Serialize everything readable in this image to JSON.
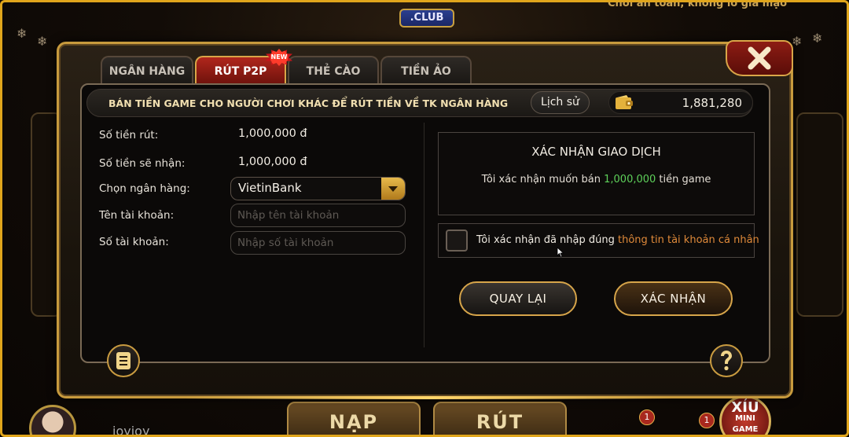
{
  "background": {
    "logo_text": ".CLUB",
    "marquee": "Chơi an toàn, không lo gia mạo",
    "username": "joyjoy",
    "bottom_buttons": [
      "NẠP",
      "RÚT"
    ],
    "mini_game": {
      "line1": "XỈU",
      "line2": "MINI",
      "line3": "GAME"
    },
    "badges": [
      "1",
      "1"
    ]
  },
  "tabs": [
    {
      "label": "NGÂN HÀNG",
      "active": false
    },
    {
      "label": "RÚT P2P",
      "active": true
    },
    {
      "label": "THẺ CÀO",
      "active": false
    },
    {
      "label": "TIỀN ẢO",
      "active": false
    }
  ],
  "new_badge": "NEW",
  "header": {
    "title": "BÁN TIỀN GAME CHO NGƯỜI CHƠI KHÁC ĐỂ RÚT TIỀN VỀ TK NGÂN HÀNG",
    "history_label": "Lịch sử",
    "balance": "1,881,280"
  },
  "form": {
    "withdraw_label": "Số tiền rút:",
    "withdraw_value": "1,000,000 đ",
    "receive_label": "Số tiền sẽ nhận:",
    "receive_value": "1,000,000 đ",
    "bank_label": "Chọn ngân hàng:",
    "bank_value": "VietinBank",
    "account_name_label": "Tên tài khoản:",
    "account_name_placeholder": "Nhập tên tài khoản",
    "account_number_label": "Số tài khoản:",
    "account_number_placeholder": "Nhập số tài khoản"
  },
  "confirm": {
    "title": "XÁC NHẬN GIAO DỊCH",
    "text_before": "Tôi xác nhận muốn bán ",
    "amount": "1,000,000",
    "text_after": " tiền game",
    "checkbox_text": "Tôi xác nhận đã nhập đúng ",
    "checkbox_highlight": "thông tin tài khoản cá nhân",
    "back_label": "QUAY LẠI",
    "confirm_label": "XÁC NHẬN"
  },
  "icons": {
    "close": "close-icon",
    "wallet": "wallet-icon",
    "notes": "notes-icon",
    "help": "help-icon",
    "dropdown": "chevron-down-icon"
  },
  "colors": {
    "gold": "#c79a3d",
    "active_tab": "#b0261c",
    "amount_green": "#5ed15a",
    "highlight_orange": "#e08a3a"
  }
}
